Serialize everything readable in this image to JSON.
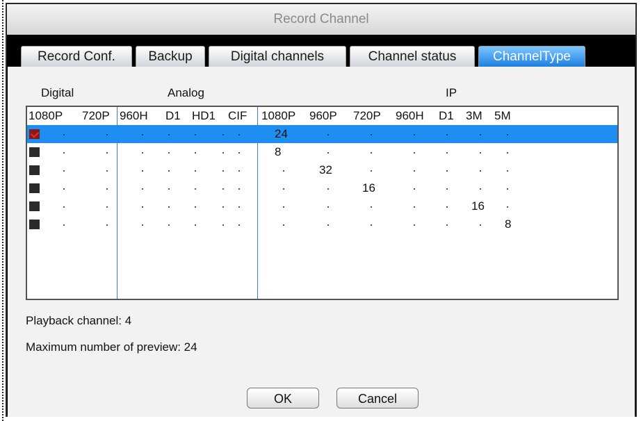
{
  "window": {
    "title": "Record Channel"
  },
  "tabs": [
    {
      "label": "Record Conf."
    },
    {
      "label": "Backup"
    },
    {
      "label": "Digital channels"
    },
    {
      "label": "Channel status"
    },
    {
      "label": "ChannelType"
    }
  ],
  "active_tab": "ChannelType",
  "groups": {
    "digital": "Digital",
    "analog": "Analog",
    "ip": "IP"
  },
  "columns": {
    "digital": [
      "1080P",
      "720P"
    ],
    "analog": [
      "960H",
      "D1",
      "HD1",
      "CIF"
    ],
    "ip": [
      "1080P",
      "960P",
      "720P",
      "960H",
      "D1",
      "3M",
      "5M"
    ]
  },
  "rows": [
    {
      "selected": true,
      "checked": true,
      "value": "24",
      "ip_index": 0
    },
    {
      "selected": false,
      "checked": false,
      "value": "8",
      "ip_index": 0
    },
    {
      "selected": false,
      "checked": false,
      "value": "32",
      "ip_index": 1
    },
    {
      "selected": false,
      "checked": false,
      "value": "16",
      "ip_index": 2
    },
    {
      "selected": false,
      "checked": false,
      "value": "16",
      "ip_index": 5
    },
    {
      "selected": false,
      "checked": false,
      "value": "8",
      "ip_index": 6
    }
  ],
  "info": {
    "playback": "Playback channel: 4",
    "max_preview": "Maximum number of preview: 24"
  },
  "buttons": {
    "ok": "OK",
    "cancel": "Cancel"
  },
  "colors": {
    "accent": "#1e8ff0",
    "tab_active": "#1d7fe0",
    "divider": "#2a7fd8"
  }
}
